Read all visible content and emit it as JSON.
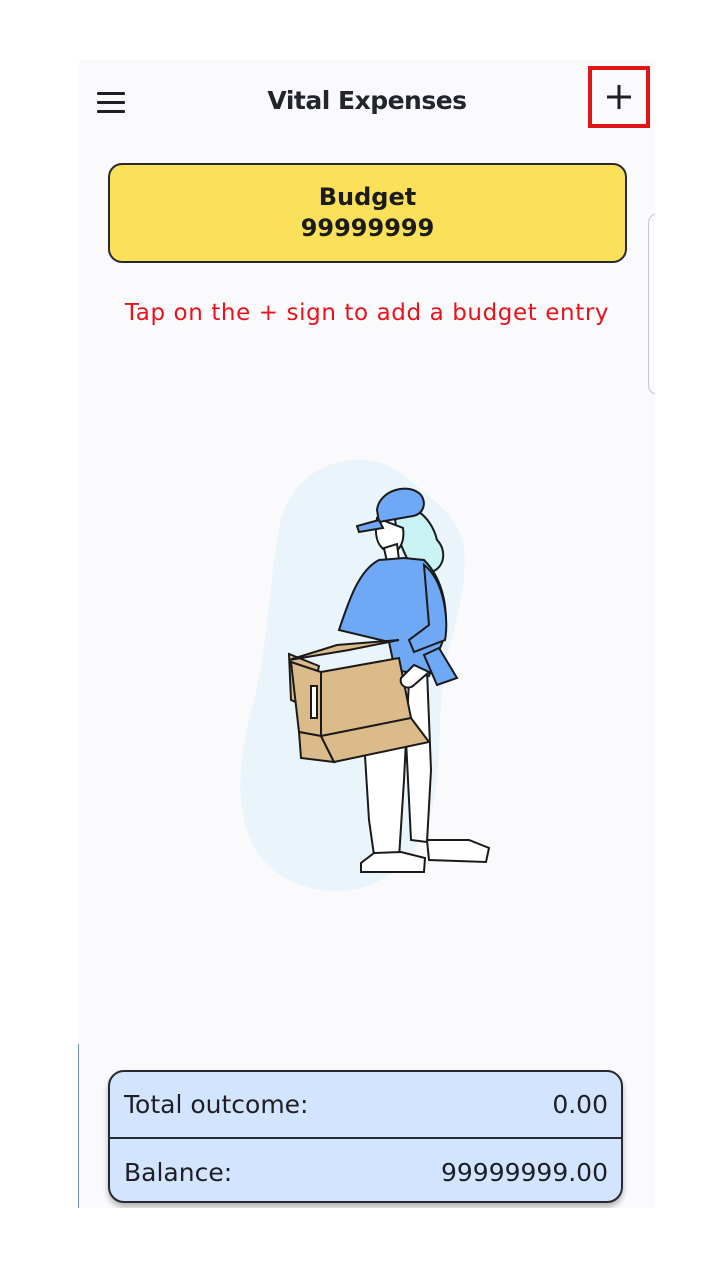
{
  "appbar": {
    "title": "Vital Expenses",
    "menu_icon": "hamburger-menu-icon",
    "add_icon": "plus-icon"
  },
  "budget": {
    "label": "Budget",
    "value": "99999999"
  },
  "hint": "Tap on the + sign to add a budget entry",
  "summary": {
    "total_outcome_label": "Total outcome:",
    "total_outcome_value": "0.00",
    "balance_label": "Balance:",
    "balance_value": "99999999.00"
  },
  "illustration": {
    "icon": "person-holding-box-illustration"
  },
  "colors": {
    "background": "#fafafd",
    "budget_card": "#fbe05a",
    "hint_text": "#e8121b",
    "summary_card": "#d3e4ff",
    "highlight_border": "#e01616",
    "illustration_blue": "#6fa8f5",
    "illustration_box": "#dcbb8a"
  }
}
